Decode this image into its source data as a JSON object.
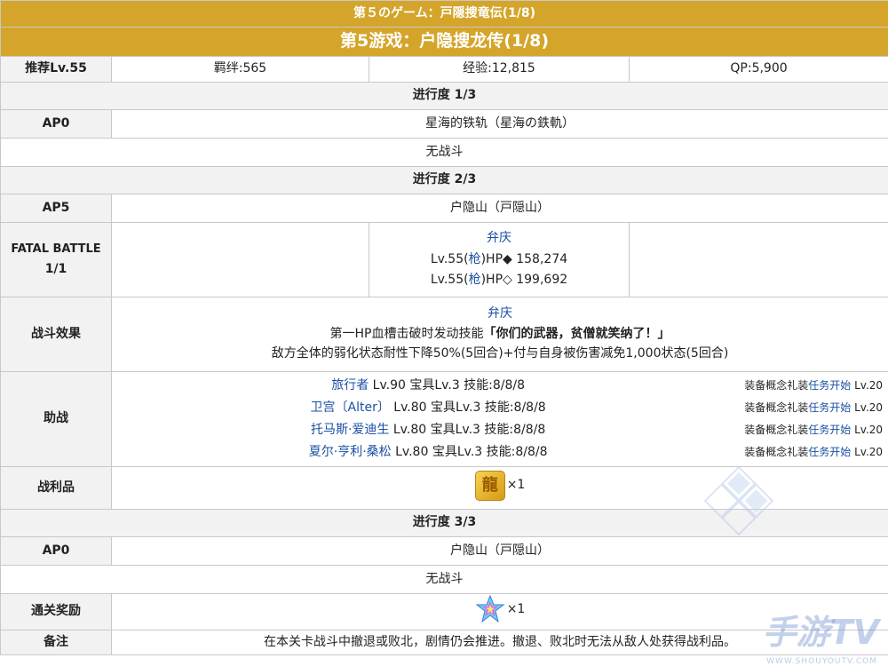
{
  "header": {
    "subtitle_jp": "第５のゲーム：戸隠捜竜伝(1/8)",
    "title": "第5游戏：户隐搜龙传(1/8)"
  },
  "summary": {
    "recommend": "推荐Lv.55",
    "bond": "羁绊:565",
    "exp": "经验:12,815",
    "qp": "QP:5,900"
  },
  "stage1": {
    "progress": "进行度 1/3",
    "ap_label": "AP0",
    "location": "星海的铁轨（星海の鉄軌）",
    "battle": "无战斗"
  },
  "stage2": {
    "progress": "进行度 2/3",
    "ap_label": "AP5",
    "location": "户隐山（戸隠山）",
    "fatal_label_1": "FATAL BATTLE",
    "fatal_label_2": "1/1",
    "enemy_name": "弁庆",
    "enemy_hp1_prefix": "Lv.55(",
    "enemy_class": "枪",
    "enemy_hp1_suffix": ")HP◆ 158,274",
    "enemy_hp2_suffix": ")HP◇ 199,692",
    "effect_label": "战斗效果",
    "effect_name": "弁庆",
    "effect_line1_prefix": "第一HP血槽击破时发动技能",
    "effect_skill": "「你们的武器，贫僧就笑纳了！」",
    "effect_line2": "敌方全体的弱化状态耐性下降50%(5回合)+付与自身被伤害减免1,000状态(5回合)",
    "support_label": "助战",
    "supports": [
      {
        "name": "旅行者",
        "stats": " Lv.90 宝具Lv.3 技能:8/8/8",
        "ce_prefix": "装备概念礼装",
        "ce_name": "任务开始",
        "ce_lv": " Lv.20"
      },
      {
        "name": "卫宫〔Alter〕",
        "stats": " Lv.80 宝具Lv.3 技能:8/8/8",
        "ce_prefix": "装备概念礼装",
        "ce_name": "任务开始",
        "ce_lv": " Lv.20"
      },
      {
        "name": "托马斯·爱迪生",
        "stats": " Lv.80 宝具Lv.3 技能:8/8/8",
        "ce_prefix": "装备概念礼装",
        "ce_name": "任务开始",
        "ce_lv": " Lv.20"
      },
      {
        "name": "夏尔·亨利·桑松",
        "stats": " Lv.80 宝具Lv.3 技能:8/8/8",
        "ce_prefix": "装备概念礼装",
        "ce_name": "任务开始",
        "ce_lv": " Lv.20"
      }
    ],
    "drop_label": "战利品",
    "drop_count": "×1",
    "drop_icon": "dragon-token-icon"
  },
  "stage3": {
    "progress": "进行度 3/3",
    "ap_label": "AP0",
    "location": "户隐山（戸隠山）",
    "battle": "无战斗"
  },
  "reward": {
    "label": "通关奖励",
    "count": "×1",
    "icon": "saint-quartz-icon"
  },
  "notes": {
    "label": "备注",
    "text": "在本关卡战斗中撤退或败北，剧情仍会推进。撤退、败北时无法从敌人处获得战利品。"
  },
  "watermark": {
    "text": "手游TV",
    "url": "WWW.SHOUYOUTV.COM"
  },
  "colors": {
    "header_gold": "#d4a52a",
    "label_bg": "#f2f2f2",
    "link_blue": "#1b4fa3",
    "border": "#c8c8c8"
  }
}
